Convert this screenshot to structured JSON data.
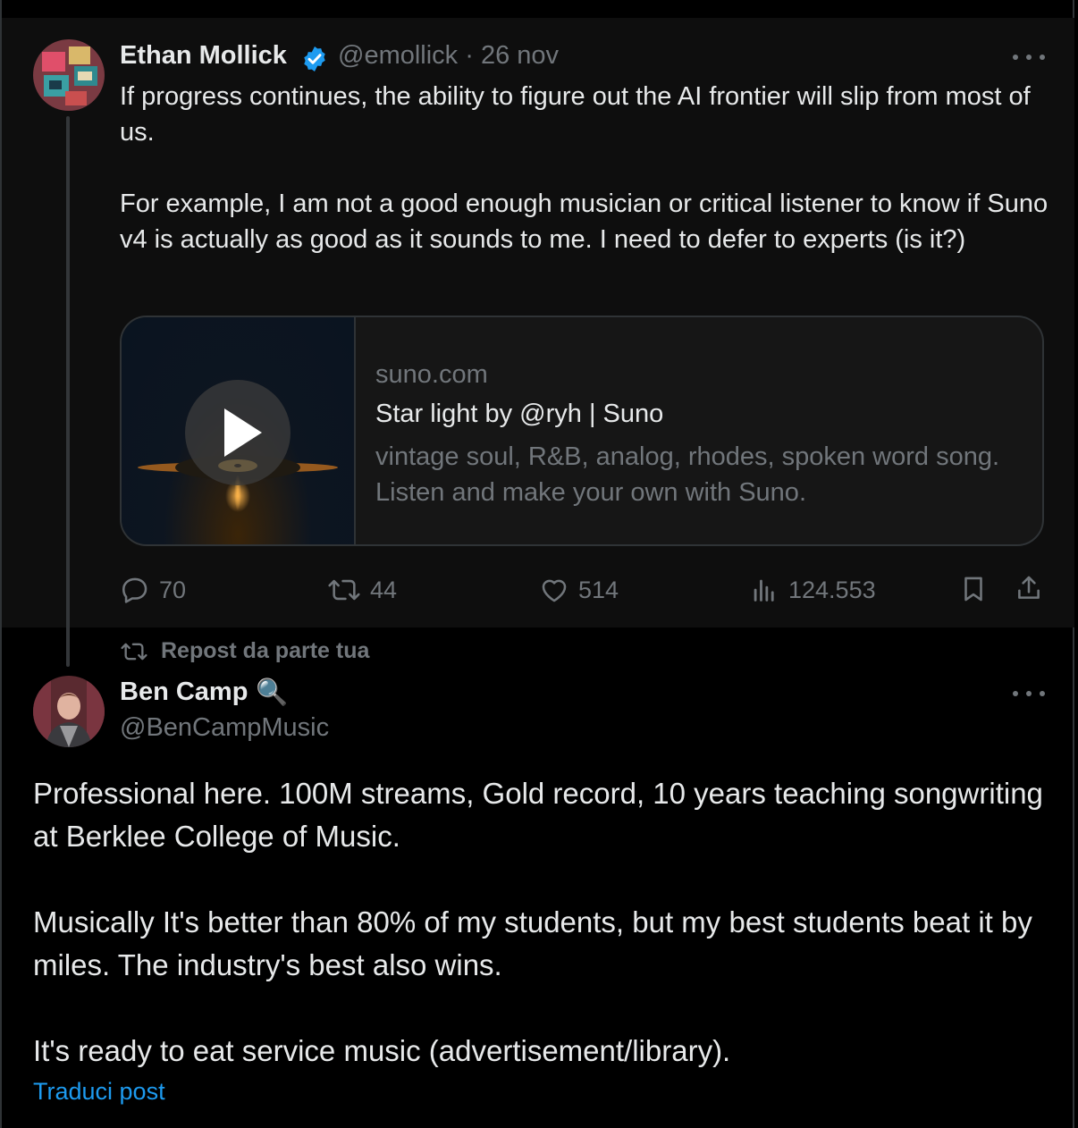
{
  "tweet1": {
    "author_name": "Ethan Mollick",
    "verified_icon": "verified-badge-icon",
    "handle": "@emollick",
    "separator": "·",
    "date": "26 nov",
    "text": "If progress continues, the ability to figure out the AI frontier will slip from most of us.\n\nFor example, I am not a good enough musician or critical listener to know if Suno v4 is actually as good as it sounds to me. I need to defer to experts (is it?)",
    "card": {
      "domain": "suno.com",
      "title": "Star light by @ryh | Suno",
      "description": "vintage soul, R&B, analog, rhodes, spoken word song. Listen and make your own with Suno."
    },
    "actions": {
      "replies": "70",
      "reposts": "44",
      "likes": "514",
      "views": "124.553"
    }
  },
  "repost_label": "Repost da parte tua",
  "tweet2": {
    "author_name": "Ben Camp",
    "emoji": "🔍",
    "handle": "@BenCampMusic",
    "text": "Professional here. 100M streams, Gold record, 10 years teaching songwriting at Berklee College of Music.\n\nMusically It's better than 80% of my students, but my best students beat it by miles. The industry's best also wins.\n\nIt's ready to eat service music (advertisement/library).",
    "translate_label": "Traduci post"
  },
  "colors": {
    "background": "#000000",
    "tweet_highlight": "#0e0e0e",
    "text": "#e7e9ea",
    "muted": "#71767b",
    "link": "#1d9bf0",
    "verified": "#1d9bf0"
  }
}
